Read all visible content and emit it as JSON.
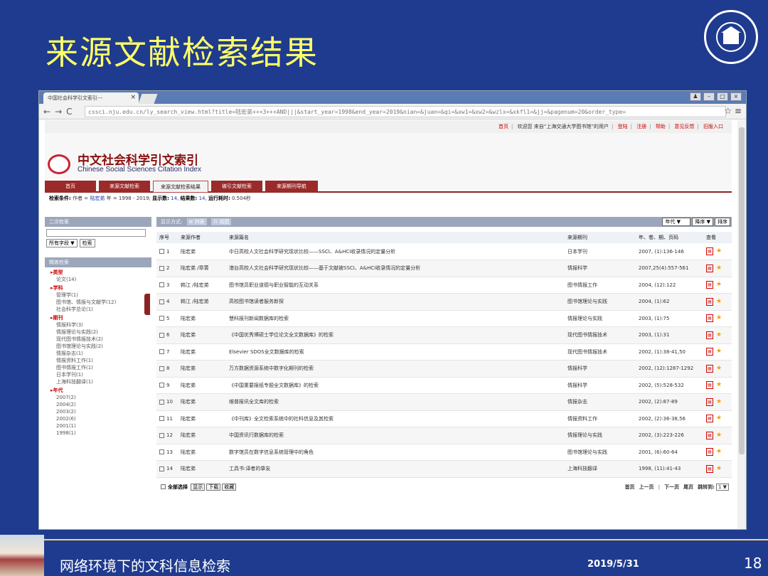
{
  "slide": {
    "title": "来源文献检索结果",
    "footer_title": "网络环境下的文科信息检索",
    "date": "2019/5/31",
    "page": "18"
  },
  "browser": {
    "tab_title": "中国社会科学引文索引---",
    "url": "cssci.nju.edu.cn/ly_search_view.html?title=陆宏弟+++3+++AND|||&start_year=1998&end_year=2019&nian=&juan=&qi=&xw1=&xw2=&wzlx=&xkfl1=&jj=&pagenum=20&order_type="
  },
  "toplinks": [
    "首页",
    "欢迎您 来自“上海交通大学图书馆”的用户",
    "登陆",
    "注册",
    "帮助",
    "意见反馈",
    "旧版入口"
  ],
  "site": {
    "name_cn": "中文社会科学引文索引",
    "name_en": "Chinese Social Sciences Citation Index"
  },
  "menu": [
    "首页",
    "来源文献检索",
    "来源文献检索结果",
    "被引文献检索",
    "来源期刊导航"
  ],
  "conditions": {
    "label": "检索条件:",
    "text1": "作者 = ",
    "author": "陆宏弟",
    "text2": " 年 = 1998 - 2019; ",
    "shown_label": "显示数:",
    "shown": "14",
    "results_label": "结果数:",
    "results": "14",
    "time_label": "运行耗时:",
    "time": "0.504秒"
  },
  "left": {
    "secondary": "二次检索",
    "select": "所有字段 ▼",
    "search_btn": "检索",
    "refine": "精炼检索",
    "type_h": "▸类型",
    "type_items": [
      "论文(14)"
    ],
    "subject_h": "▸学科",
    "subject_items": [
      "管理学(1)",
      "图书馆、情报与文献学(12)",
      "社会科学总论(1)"
    ],
    "journal_h": "▸期刊",
    "journal_items": [
      "情报科学(3)",
      "情报理论与实践(2)",
      "现代图书情报技术(2)",
      "图书馆理论与实践(2)",
      "情报杂志(1)",
      "情报资料工作(1)",
      "图书情报工作(1)",
      "日本学刊(1)",
      "上海科技翻译(1)"
    ],
    "year_h": "▸年代",
    "year_items": [
      "2007(2)",
      "2004(2)",
      "2003(2)",
      "2002(6)",
      "2001(1)",
      "1998(1)"
    ]
  },
  "toolbar": {
    "display_label": "显示方式:",
    "list": "≡ 列表",
    "view": "☷ 视图",
    "year_sel": "年代 ▼",
    "order_sel": "降序 ▼",
    "sort_btn": "排序"
  },
  "headers": [
    "序号",
    "来源作者",
    "来源篇名",
    "来源期刊",
    "年、卷、期、页码",
    "查看"
  ],
  "rows": [
    {
      "n": "1",
      "a": "陆宏弟",
      "t": "中日高校人文社会科学研究现状比较——SSCI、A&HCI收录情况的定量分析",
      "j": "日本学刊",
      "y": "2007, (1):136-146"
    },
    {
      "n": "2",
      "a": "陆宏弟 /章菁",
      "t": "港台高校人文社会科学研究现状比较——基于文献被SSCI、A&HCI收录情况的定量分析",
      "j": "情报科学",
      "y": "2007,25(4):557-561"
    },
    {
      "n": "3",
      "a": "韩江 /陆宏弟",
      "t": "图书馆员职业道德与职业智能的互动关系",
      "j": "图书情报工作",
      "y": "2004, (12):122"
    },
    {
      "n": "4",
      "a": "韩江 /陆宏弟",
      "t": "高校图书馆读者服务新探",
      "j": "图书馆理论与实践",
      "y": "2004, (1):62"
    },
    {
      "n": "5",
      "a": "陆宏弟",
      "t": "慧科报刊新闻数据库的检索",
      "j": "情报理论与实践",
      "y": "2003, (1):75"
    },
    {
      "n": "6",
      "a": "陆宏弟",
      "t": "《中国优秀博硕士学位论文全文数据库》的检索",
      "j": "现代图书情报技术",
      "y": "2003, (1):31"
    },
    {
      "n": "7",
      "a": "陆宏弟",
      "t": "Elsevier SDOS全文数据库的检索",
      "j": "现代图书情报技术",
      "y": "2002, (1):38-41,50"
    },
    {
      "n": "8",
      "a": "陆宏弟",
      "t": "万方数据资源系统中数字化期刊的检索",
      "j": "情报科学",
      "y": "2002, (12):1287-1292"
    },
    {
      "n": "9",
      "a": "陆宏弟",
      "t": "《中国重要报纸专题全文数据库》的检索",
      "j": "情报科学",
      "y": "2002, (5):528-532"
    },
    {
      "n": "10",
      "a": "陆宏弟",
      "t": "维普报讯全文库的检索",
      "j": "情报杂志",
      "y": "2002, (2):87-89"
    },
    {
      "n": "11",
      "a": "陆宏弟",
      "t": "《中刊库》全文检索系统中的社科信息及其检索",
      "j": "情报资料工作",
      "y": "2002, (2):36-38,56"
    },
    {
      "n": "12",
      "a": "陆宏弟",
      "t": "中国资讯行数据库的检索",
      "j": "情报理论与实践",
      "y": "2002, (3):223-226"
    },
    {
      "n": "13",
      "a": "陆宏弟",
      "t": "数字馆员在数字信息系统管理中的角色",
      "j": "图书馆理论与实践",
      "y": "2001, (6):60-64"
    },
    {
      "n": "14",
      "a": "陆宏弟",
      "t": "工具书:译者的挚友",
      "j": "上海科技翻译",
      "y": "1998, (11):41-43"
    }
  ],
  "footer": {
    "select_all": "全部选择",
    "show": "显示",
    "download": "下载",
    "collect": "收藏",
    "first": "首页",
    "prev": "上一页",
    "next": "下一页",
    "last": "尾页",
    "jump": "跳转到:",
    "jump_val": "1 ▼"
  },
  "colors": {
    "background": "#1f3b8f",
    "title": "#ffff66",
    "accent": "#9b2a2a"
  }
}
